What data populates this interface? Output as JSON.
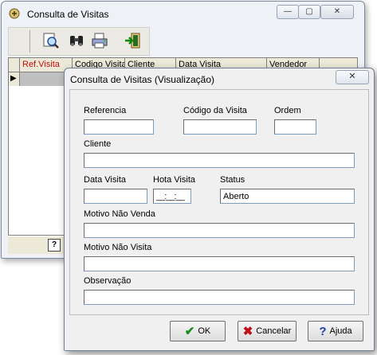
{
  "back_window": {
    "title": "Consulta de Visitas",
    "controls": {
      "minimize": "—",
      "maximize": "▢",
      "close": "✕"
    },
    "toolbar_icons": [
      "find-icon",
      "binoculars-icon",
      "print-icon",
      "exit-icon"
    ],
    "grid": {
      "columns": [
        "Ref.Visita",
        "Codigo Visita",
        "Cliente",
        "Data Visita",
        "Vendedor"
      ],
      "row_marker": "▶"
    },
    "status_help": "?"
  },
  "dialog": {
    "title": "Consulta de Visitas (Visualização)",
    "close_glyph": "✕",
    "fields": {
      "referencia": {
        "label": "Referencia",
        "value": ""
      },
      "codigo_visita": {
        "label": "Código da Visita",
        "value": ""
      },
      "ordem": {
        "label": "Ordem",
        "value": ""
      },
      "cliente": {
        "label": "Cliente",
        "value": ""
      },
      "data_visita": {
        "label": "Data Visita",
        "value": ""
      },
      "hora_visita": {
        "label": "Hota Visita",
        "value": "__:__:__"
      },
      "status": {
        "label": "Status",
        "value": "Aberto"
      },
      "motivo_nao_venda": {
        "label": "Motivo Não Venda",
        "value": ""
      },
      "motivo_nao_visita": {
        "label": "Motivo Não Visita",
        "value": ""
      },
      "observacao": {
        "label": "Observação",
        "value": ""
      }
    },
    "buttons": {
      "ok": {
        "label": "OK",
        "glyph": "✔",
        "color": "#1a8c1a"
      },
      "cancelar": {
        "label": "Cancelar",
        "glyph": "✖",
        "color": "#c0101a"
      },
      "ajuda": {
        "label": "Ajuda",
        "glyph": "?",
        "color": "#2040a0"
      }
    }
  }
}
